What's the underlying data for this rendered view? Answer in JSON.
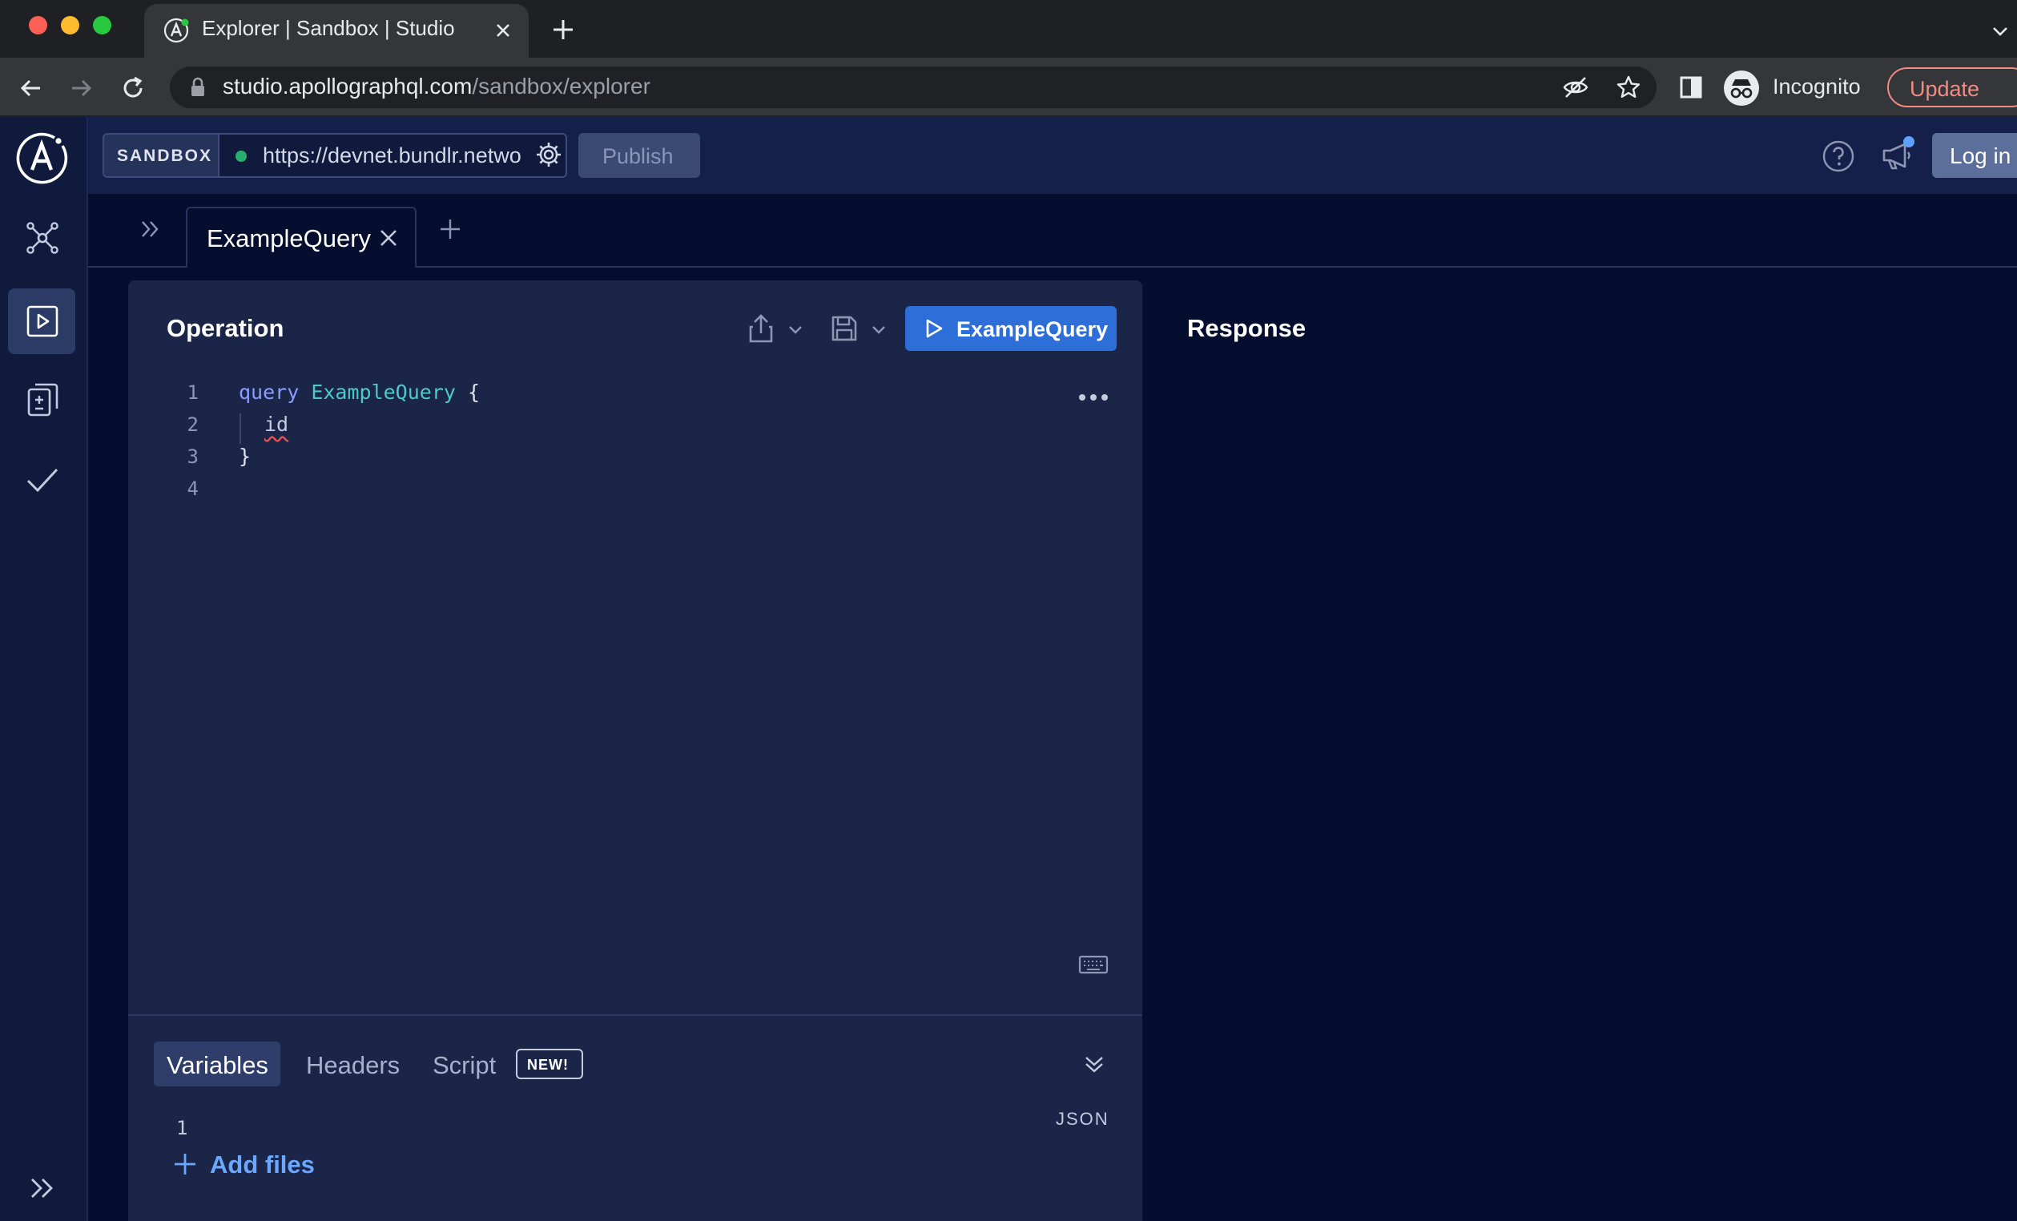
{
  "browser": {
    "tab_title": "Explorer | Sandbox | Studio",
    "url_host": "studio.apollographql.com",
    "url_path": "/sandbox/explorer",
    "profile_label": "Incognito",
    "update_label": "Update"
  },
  "header": {
    "sandbox_label": "SANDBOX",
    "endpoint_url": "https://devnet.bundlr.network/graphql",
    "endpoint_status_color": "#26b06b",
    "publish_label": "Publish",
    "login_label": "Log in"
  },
  "sidebar": {
    "items": [
      {
        "icon": "schema-icon",
        "active": false
      },
      {
        "icon": "explorer-icon",
        "active": true
      },
      {
        "icon": "changelog-icon",
        "active": false
      },
      {
        "icon": "checks-icon",
        "active": false
      }
    ],
    "expand_icon": "double-chevron-right-icon"
  },
  "operation_tabs": [
    {
      "label": "ExampleQuery",
      "active": true
    }
  ],
  "operation": {
    "heading": "Operation",
    "run_label": "ExampleQuery",
    "run_color": "#2d6ed8",
    "code_lines": [
      {
        "number": "1",
        "keyword": "query",
        "name": "ExampleQuery",
        "brace": "{"
      },
      {
        "number": "2",
        "field": "id"
      },
      {
        "number": "3",
        "brace": "}"
      },
      {
        "number": "4"
      }
    ]
  },
  "variables_panel": {
    "tabs": {
      "variables": "Variables",
      "headers": "Headers",
      "script": "Script"
    },
    "new_badge": "NEW!",
    "line_number": "1",
    "format_label": "JSON",
    "add_files_label": "Add files"
  },
  "response": {
    "heading": "Response"
  }
}
